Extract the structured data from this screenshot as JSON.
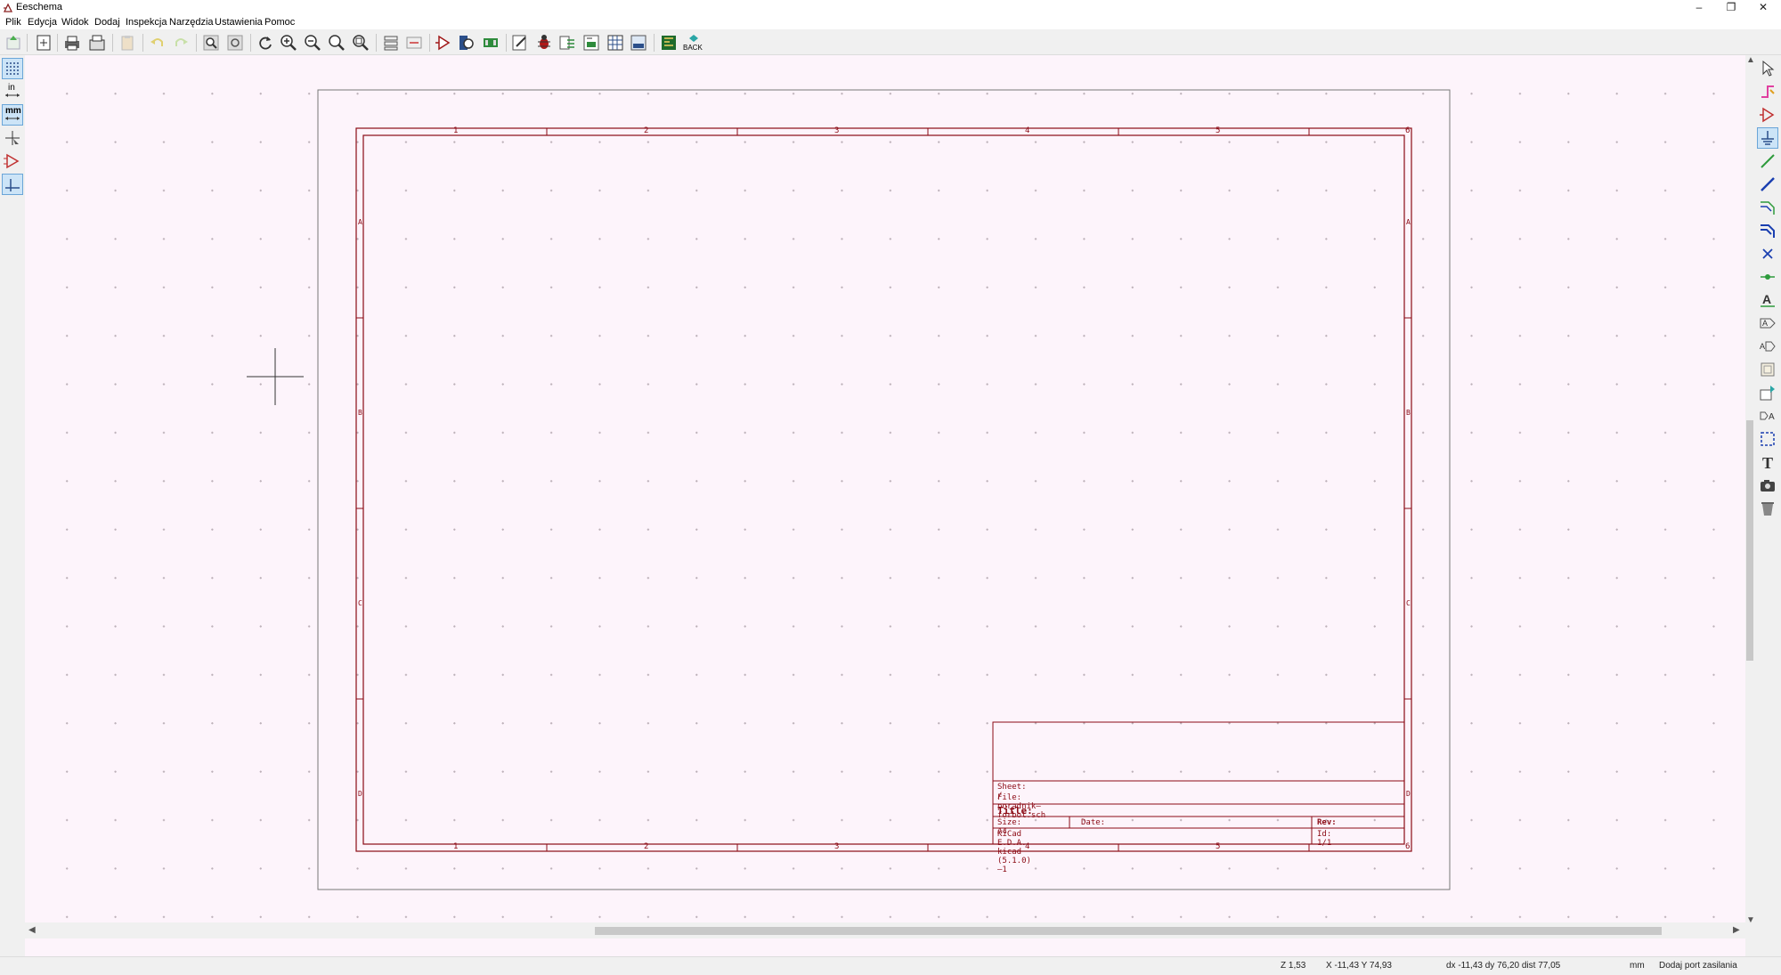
{
  "window": {
    "title": "Eeschema",
    "minimize": "–",
    "restore": "❐",
    "close": "✕"
  },
  "menu": [
    "Plik",
    "Edycja",
    "Widok",
    "Dodaj",
    "Inspekcja",
    "Narzędzia",
    "Ustawienia",
    "Pomoc"
  ],
  "toolbar": {
    "back_label": "BACK"
  },
  "left_toolbar": {
    "units_in": "in",
    "units_mm": "mm"
  },
  "sheet": {
    "col_labels": [
      "1",
      "2",
      "3",
      "4",
      "5",
      "6"
    ],
    "row_labels": [
      "A",
      "B",
      "C",
      "D"
    ],
    "title_block": {
      "sheet": "Sheet: /",
      "file": "File: poradnik—forbot.sch",
      "title": "Title:",
      "size": "Size: A4",
      "date": "Date:",
      "rev": "Rev:",
      "generator": "KiCad E.D.A.  kicad (5.1.0)—1",
      "id": "Id: 1/1"
    }
  },
  "status": {
    "zoom": "Z 1,53",
    "cursor": "X -11,43  Y 74,93",
    "delta": "dx -11,43  dy 76,20  dist 77,05",
    "units": "mm",
    "mode": "Dodaj port zasilania"
  },
  "colors": {
    "sheet": "#8b0a14",
    "canvas_bg": "#fdf4fb",
    "accent": "#0078d7"
  }
}
